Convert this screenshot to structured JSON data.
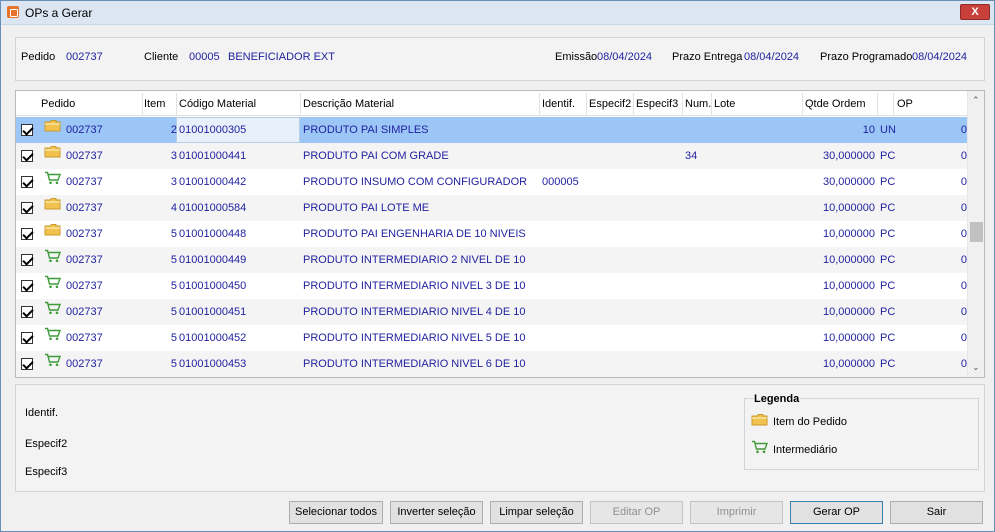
{
  "window": {
    "title": "OPs a Gerar",
    "close_label": "X"
  },
  "header": {
    "pedido_label": "Pedido",
    "pedido_value": "002737",
    "cliente_label": "Cliente",
    "cliente_code": "00005",
    "cliente_name": "BENEFICIADOR EXT",
    "emissao_label": "Emissão",
    "emissao_value": "08/04/2024",
    "prazo_entrega_label": "Prazo Entrega",
    "prazo_entrega_value": "08/04/2024",
    "prazo_programado_label": "Prazo Programado",
    "prazo_programado_value": "08/04/2024"
  },
  "grid": {
    "columns": [
      "Pedido",
      "Item",
      "Código Material",
      "Descrição Material",
      "Identif.",
      "Especif2",
      "Especif3",
      "Num.",
      "Lote",
      "Qtde Ordem",
      "OP"
    ],
    "rows": [
      {
        "checked": true,
        "icon": "folder-icon",
        "pedido": "002737",
        "item": "2",
        "codigo": "01001000305",
        "descricao": "PRODUTO PAI SIMPLES",
        "identif": "",
        "num": "",
        "qtde": "10",
        "un": "UN",
        "op": "0"
      },
      {
        "checked": true,
        "icon": "folder-icon",
        "pedido": "002737",
        "item": "3",
        "codigo": "01001000441",
        "descricao": "PRODUTO PAI COM GRADE",
        "identif": "",
        "num": "34",
        "qtde": "30,000000",
        "un": "PC",
        "op": "0"
      },
      {
        "checked": true,
        "icon": "cart-icon",
        "pedido": "002737",
        "item": "3",
        "codigo": "01001000442",
        "descricao": "PRODUTO INSUMO COM CONFIGURADOR",
        "identif": "000005",
        "num": "",
        "qtde": "30,000000",
        "un": "PC",
        "op": "0"
      },
      {
        "checked": true,
        "icon": "folder-icon",
        "pedido": "002737",
        "item": "4",
        "codigo": "01001000584",
        "descricao": "PRODUTO PAI LOTE ME",
        "identif": "",
        "num": "",
        "qtde": "10,000000",
        "un": "PC",
        "op": "0"
      },
      {
        "checked": true,
        "icon": "folder-icon",
        "pedido": "002737",
        "item": "5",
        "codigo": "01001000448",
        "descricao": "PRODUTO PAI ENGENHARIA DE 10 NIVEIS",
        "identif": "",
        "num": "",
        "qtde": "10,000000",
        "un": "PC",
        "op": "0"
      },
      {
        "checked": true,
        "icon": "cart-icon",
        "pedido": "002737",
        "item": "5",
        "codigo": "01001000449",
        "descricao": "PRODUTO INTERMEDIARIO 2 NIVEL DE 10",
        "identif": "",
        "num": "",
        "qtde": "10,000000",
        "un": "PC",
        "op": "0"
      },
      {
        "checked": true,
        "icon": "cart-icon",
        "pedido": "002737",
        "item": "5",
        "codigo": "01001000450",
        "descricao": "PRODUTO INTERMEDIARIO NIVEL 3 DE 10",
        "identif": "",
        "num": "",
        "qtde": "10,000000",
        "un": "PC",
        "op": "0"
      },
      {
        "checked": true,
        "icon": "cart-icon",
        "pedido": "002737",
        "item": "5",
        "codigo": "01001000451",
        "descricao": "PRODUTO INTERMEDIARIO NIVEL 4 DE 10",
        "identif": "",
        "num": "",
        "qtde": "10,000000",
        "un": "PC",
        "op": "0"
      },
      {
        "checked": true,
        "icon": "cart-icon",
        "pedido": "002737",
        "item": "5",
        "codigo": "01001000452",
        "descricao": "PRODUTO INTERMEDIARIO NIVEL 5 DE 10",
        "identif": "",
        "num": "",
        "qtde": "10,000000",
        "un": "PC",
        "op": "0"
      },
      {
        "checked": true,
        "icon": "cart-icon",
        "pedido": "002737",
        "item": "5",
        "codigo": "01001000453",
        "descricao": "PRODUTO INTERMEDIARIO NIVEL 6 DE 10",
        "identif": "",
        "num": "",
        "qtde": "10,000000",
        "un": "PC",
        "op": "0"
      }
    ]
  },
  "details": {
    "identif_label": "Identif.",
    "especif2_label": "Especif2",
    "especif3_label": "Especif3"
  },
  "legend": {
    "title": "Legenda",
    "item_pedido": "Item do Pedido",
    "intermediario": "Intermediário"
  },
  "buttons": {
    "select_all": "Selecionar todos",
    "invert": "Inverter seleção",
    "clear": "Limpar seleção",
    "edit_op": "Editar OP",
    "print": "Imprimir",
    "generate_op": "Gerar OP",
    "exit": "Sair"
  },
  "colors": {
    "value_text": "#1f1fa0",
    "selected_row": "#9bc6f5",
    "close_button": "#c9403a",
    "folder": "#f2c24f",
    "cart": "#3f9a3a"
  }
}
